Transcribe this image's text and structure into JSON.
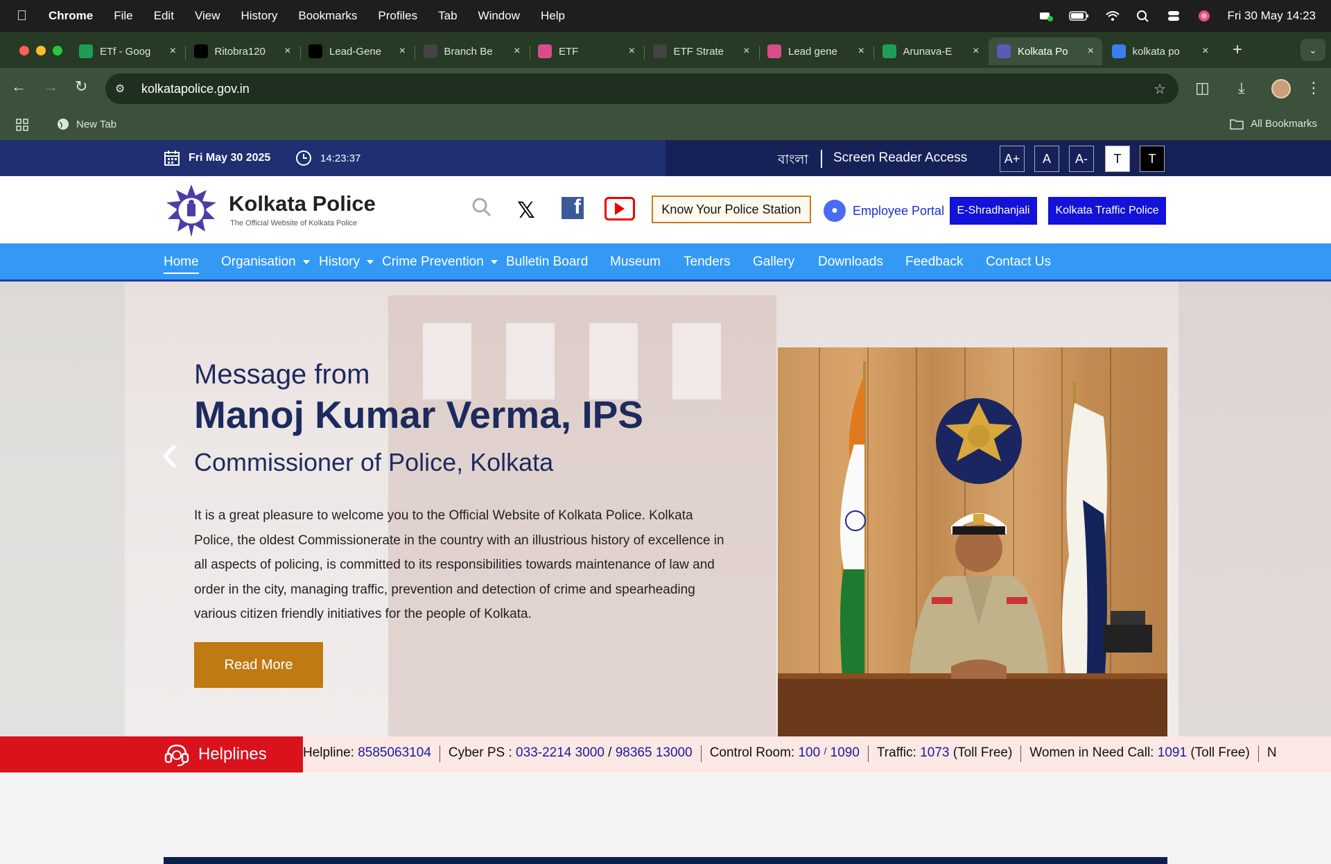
{
  "menubar": {
    "app": "Chrome",
    "items": [
      "File",
      "Edit",
      "View",
      "History",
      "Bookmarks",
      "Profiles",
      "Tab",
      "Window",
      "Help"
    ],
    "clock": "Fri 30 May  14:23"
  },
  "tabs": [
    {
      "label": "ETf - Goog",
      "icon": "sheets-icon",
      "color": "#1e9e55"
    },
    {
      "label": "Ritobra120",
      "icon": "github-icon",
      "color": "#000000"
    },
    {
      "label": "Lead-Gene",
      "icon": "github-icon",
      "color": "#000000"
    },
    {
      "label": "Branch Be",
      "icon": "openai-icon",
      "color": "#444444"
    },
    {
      "label": "ETF",
      "icon": "app-icon",
      "color": "#d94c8a"
    },
    {
      "label": "ETF Strate",
      "icon": "sync-icon",
      "color": "#444444"
    },
    {
      "label": "Lead gene",
      "icon": "app-icon",
      "color": "#d94c8a"
    },
    {
      "label": "Arunava-E",
      "icon": "sheets-icon",
      "color": "#1e9e55"
    },
    {
      "label": "Kolkata Po",
      "icon": "police-icon",
      "color": "#5a5ab8"
    },
    {
      "label": "kolkata po",
      "icon": "docs-icon",
      "color": "#3b7ded"
    }
  ],
  "browser": {
    "url": "kolkatapolice.gov.in",
    "bookmark_newtab": "New Tab",
    "all_bookmarks": "All Bookmarks"
  },
  "topbar": {
    "date": "Fri May 30 2025",
    "time": "14:23:37",
    "language": "বাংলা",
    "screen_reader": "Screen Reader Access",
    "font_buttons": [
      "A+",
      "A",
      "A-",
      "T",
      "T"
    ]
  },
  "header": {
    "title": "Kolkata Police",
    "subtitle": "The Official Website of Kolkata Police",
    "know_ps": "Know Your Police Station",
    "employee_portal": "Employee Portal",
    "e_shradhanjali": "E-Shradhanjali",
    "traffic_police": "Kolkata Traffic Police"
  },
  "nav": [
    {
      "label": "Home",
      "dropdown": false
    },
    {
      "label": "Organisation",
      "dropdown": true
    },
    {
      "label": "History",
      "dropdown": true
    },
    {
      "label": "Crime Prevention",
      "dropdown": true
    },
    {
      "label": "Bulletin Board",
      "dropdown": false
    },
    {
      "label": "Museum",
      "dropdown": false
    },
    {
      "label": "Tenders",
      "dropdown": false
    },
    {
      "label": "Gallery",
      "dropdown": false
    },
    {
      "label": "Downloads",
      "dropdown": false
    },
    {
      "label": "Feedback",
      "dropdown": false
    },
    {
      "label": "Contact Us",
      "dropdown": false
    }
  ],
  "hero": {
    "message_from": "Message from",
    "name": "Manoj Kumar Verma, IPS",
    "role": "Commissioner of Police, Kolkata",
    "body": "It is a great pleasure to welcome you to the Official Website of Kolkata Police. Kolkata Police, the oldest Commissionerate in the country with an illustrious history of excellence in all aspects of policing, is committed to its responsibilities towards maintenance of law and order in the city, managing traffic, prevention and detection of crime and spearheading various citizen friendly initiatives for the people of Kolkata.",
    "read_more": "Read More"
  },
  "helplines": {
    "label": "Helplines",
    "helpline_label": "Helpline:",
    "helpline_num": "8585063104",
    "cyber_label": "Cyber PS :",
    "cyber_num1": "033-2214 3000",
    "cyber_slash": "/",
    "cyber_num2": "98365 13000",
    "control_label": "Control Room:",
    "control_num1": "100",
    "control_slash": "/",
    "control_num2": "1090",
    "traffic_label": "Traffic:",
    "traffic_num": "1073",
    "traffic_suffix": "(Toll Free)",
    "women_label": "Women in Need Call:",
    "women_num": "1091",
    "women_suffix": "(Toll Free)",
    "trailing": "N"
  }
}
